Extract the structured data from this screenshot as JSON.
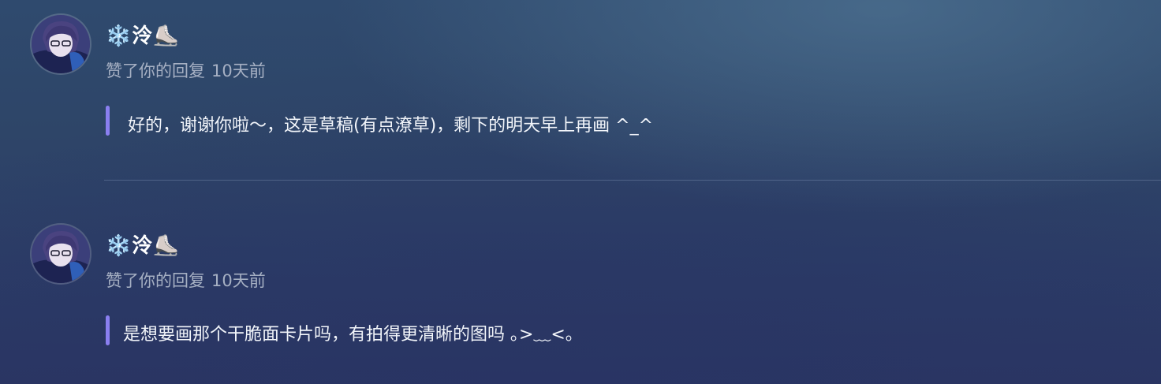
{
  "notifications": [
    {
      "username": "❄️泠⛸️",
      "action": "赞了你的回复",
      "time": "10天前",
      "reply": "好的，谢谢你啦～，这是草稿(有点潦草)，剩下的明天早上再画  ^_^"
    },
    {
      "username": "❄️泠⛸️",
      "action": "赞了你的回复",
      "time": "10天前",
      "reply": "是想要画那个干脆面卡片吗，有拍得更清晰的图吗 ｡>﹏<｡"
    }
  ],
  "colors": {
    "accent_bar": "#8a7ff0",
    "meta_text": "#a6b0c3"
  }
}
